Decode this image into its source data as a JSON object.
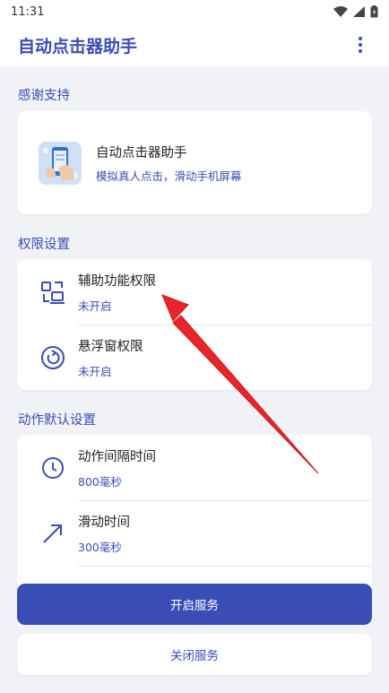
{
  "status_bar": {
    "time": "11:31"
  },
  "app_bar": {
    "title": "自动点击器助手",
    "menu_icon": "more-vert-icon"
  },
  "support": {
    "section_title": "感谢支持",
    "app_name": "自动点击器助手",
    "app_desc": "模拟真人点击，滑动手机屏幕"
  },
  "permissions": {
    "section_title": "权限设置",
    "items": [
      {
        "title": "辅助功能权限",
        "status": "未开启",
        "icon": "accessibility-icon"
      },
      {
        "title": "悬浮窗权限",
        "status": "未开启",
        "icon": "floating-window-icon"
      }
    ]
  },
  "defaults": {
    "section_title": "动作默认设置",
    "items": [
      {
        "title": "动作间隔时间",
        "value": "800毫秒",
        "icon": "clock-icon"
      },
      {
        "title": "滑动时间",
        "value": "300毫秒",
        "icon": "swipe-arrow-icon"
      }
    ]
  },
  "buttons": {
    "start": "开启服务",
    "stop": "关闭服务"
  },
  "colors": {
    "accent": "#3a4db7",
    "annotation_arrow": "#e8262a",
    "background": "#f1f2f6"
  }
}
